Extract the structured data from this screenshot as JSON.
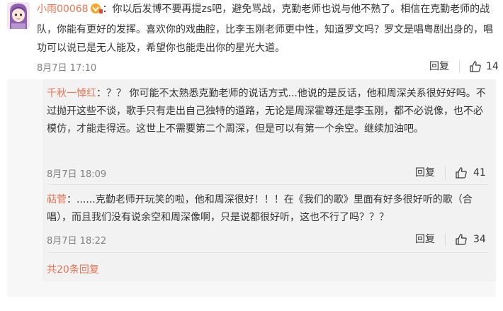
{
  "main_comment": {
    "username": "小雨00068",
    "text": "：你以后发博不要再提zs吧，避免骂战，克勤老师也说与他不熟了。相信在克勤老师的战队，你能有更好的发挥。喜欢你的戏曲腔，比李玉刚老师更中性，知道罗文吗？罗文是唱粤剧出身的，唱功可以说已是无人能及，希望你也能走出你的星光大道。",
    "date": "8月7日 17:10",
    "reply_label": "回复",
    "likes": "14"
  },
  "replies": [
    {
      "username": "千秋一悼红",
      "text": "：？？ 你可能不太熟悉克勤老师的说话方式...他说的是反话，他和周深关系很好好吗。不过抛开这些不谈，歌手只有走出自己独特的道路，无论是周深霍尊还是李玉刚，都不必说像，也不必模仿，才能走得远。这世上不需要第二个周深，但是可以有第一个余空。继续加油吧。",
      "date": "8月7日 18:09",
      "reply_label": "回复",
      "likes": "41"
    },
    {
      "username": "萜菅",
      "text": "：......克勤老师开玩笑的啦，他和周深很好！！！在《我们的歌》里面有好多很好听的歌（合唱），而且我们没有说余空和周深像啊，只是说都很好听，这也不行了吗？？？",
      "date": "8月7日 18:22",
      "reply_label": "回复",
      "likes": "34"
    }
  ],
  "more_replies": "共20条回复",
  "colors": {
    "username": "#eb7350",
    "text": "#333333",
    "meta": "#808080",
    "reply_bg": "#f2f2f2"
  },
  "icons": [
    "avatar",
    "vip-icon",
    "thumb-up-icon"
  ]
}
